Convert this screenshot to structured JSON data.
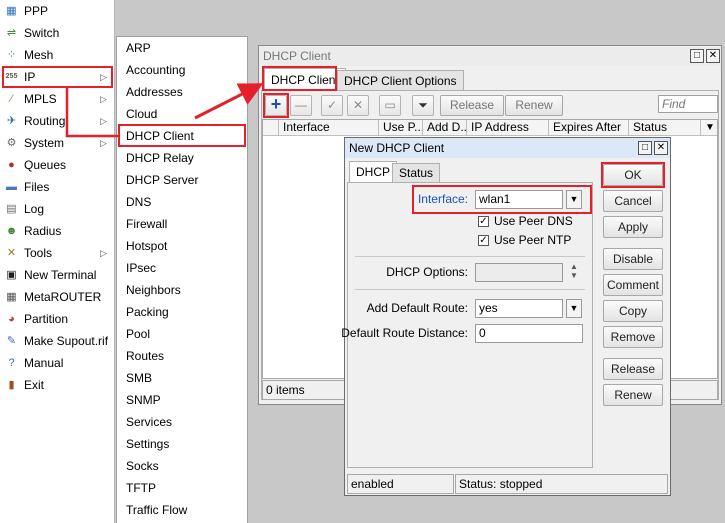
{
  "left_menu": {
    "items": [
      {
        "label": "PPP",
        "icon": "ppp-icon",
        "glyph": "▦",
        "color": "#2a6fb0",
        "arrow": false
      },
      {
        "label": "Switch",
        "icon": "switch-icon",
        "glyph": "⇌",
        "color": "#4a8a3a",
        "arrow": false
      },
      {
        "label": "Mesh",
        "icon": "mesh-icon",
        "glyph": "⁘",
        "color": "#2a6fb0",
        "arrow": false
      },
      {
        "label": "IP",
        "icon": "ip-icon",
        "glyph": "255",
        "color": "#5a5a5a",
        "arrow": true
      },
      {
        "label": "MPLS",
        "icon": "mpls-icon",
        "glyph": "∕",
        "color": "#5aa040",
        "arrow": true
      },
      {
        "label": "Routing",
        "icon": "routing-icon",
        "glyph": "✈",
        "color": "#2a6fb0",
        "arrow": true
      },
      {
        "label": "System",
        "icon": "system-icon",
        "glyph": "⚙",
        "color": "#6a6a6a",
        "arrow": true
      },
      {
        "label": "Queues",
        "icon": "queues-icon",
        "glyph": "●",
        "color": "#b03030",
        "arrow": false
      },
      {
        "label": "Files",
        "icon": "files-icon",
        "glyph": "▬",
        "color": "#4a78b8",
        "arrow": false
      },
      {
        "label": "Log",
        "icon": "log-icon",
        "glyph": "▤",
        "color": "#6a6a6a",
        "arrow": false
      },
      {
        "label": "Radius",
        "icon": "radius-icon",
        "glyph": "☻",
        "color": "#3a8a3a",
        "arrow": false
      },
      {
        "label": "Tools",
        "icon": "tools-icon",
        "glyph": "✕",
        "color": "#b07020",
        "arrow": true
      },
      {
        "label": "New Terminal",
        "icon": "terminal-icon",
        "glyph": "▣",
        "color": "#202020",
        "arrow": false
      },
      {
        "label": "MetaROUTER",
        "icon": "metarouter-icon",
        "glyph": "▦",
        "color": "#505050",
        "arrow": false
      },
      {
        "label": "Partition",
        "icon": "partition-icon",
        "glyph": "◕",
        "color": "#c03a3a",
        "arrow": false
      },
      {
        "label": "Make Supout.rif",
        "icon": "supout-icon",
        "glyph": "✎",
        "color": "#3a6ab0",
        "arrow": false
      },
      {
        "label": "Manual",
        "icon": "manual-icon",
        "glyph": "?",
        "color": "#2a6fb0",
        "arrow": false
      },
      {
        "label": "Exit",
        "icon": "exit-icon",
        "glyph": "▮",
        "color": "#a05020",
        "arrow": false
      }
    ]
  },
  "ip_submenu": {
    "items": [
      "ARP",
      "Accounting",
      "Addresses",
      "Cloud",
      "DHCP Client",
      "DHCP Relay",
      "DHCP Server",
      "DNS",
      "Firewall",
      "Hotspot",
      "IPsec",
      "Neighbors",
      "Packing",
      "Pool",
      "Routes",
      "SMB",
      "SNMP",
      "Services",
      "Settings",
      "Socks",
      "TFTP",
      "Traffic Flow"
    ]
  },
  "dhcp_client_window": {
    "title": "DHCP Client",
    "tabs": [
      "DHCP Client",
      "DHCP Client Options"
    ],
    "toolbar": {
      "release": "Release",
      "renew": "Renew",
      "find_placeholder": "Find"
    },
    "columns": [
      "Interface",
      "Use P...",
      "Add D...",
      "IP Address",
      "Expires After",
      "Status"
    ],
    "item_count": "0 items"
  },
  "new_dhcp_client_dialog": {
    "title": "New DHCP Client",
    "tabs": [
      "DHCP",
      "Status"
    ],
    "interface_label": "Interface:",
    "interface_value": "wlan1",
    "use_peer_dns_label": "Use Peer DNS",
    "use_peer_dns_checked": true,
    "use_peer_ntp_label": "Use Peer NTP",
    "use_peer_ntp_checked": true,
    "dhcp_options_label": "DHCP Options:",
    "dhcp_options_value": "",
    "add_default_route_label": "Add Default Route:",
    "add_default_route_value": "yes",
    "default_route_distance_label": "Default Route Distance:",
    "default_route_distance_value": "0",
    "buttons": {
      "ok": "OK",
      "cancel": "Cancel",
      "apply": "Apply",
      "disable": "Disable",
      "comment": "Comment",
      "copy": "Copy",
      "remove": "Remove",
      "release": "Release",
      "renew": "Renew"
    },
    "status_left": "enabled",
    "status_right": "Status: stopped"
  },
  "colors": {
    "highlight": "#e5202a",
    "dialog_title_bg": "#dbe8f7",
    "add_icon": "#1b4fbf",
    "interface_label": "#2050c0"
  }
}
